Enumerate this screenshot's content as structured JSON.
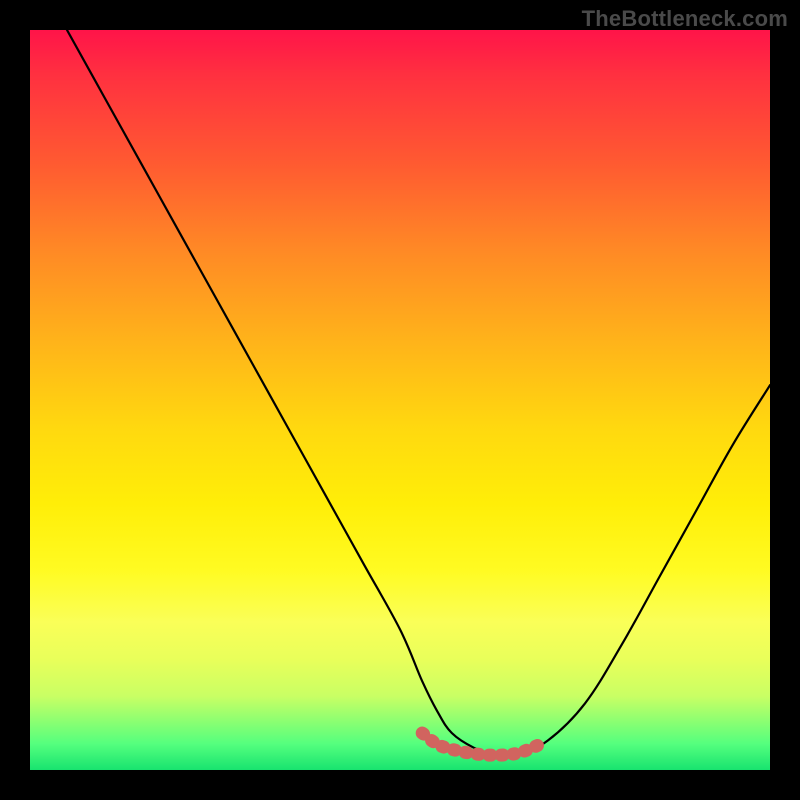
{
  "watermark": "TheBottleneck.com",
  "chart_data": {
    "type": "line",
    "title": "",
    "xlabel": "",
    "ylabel": "",
    "xlim": [
      0,
      100
    ],
    "ylim": [
      0,
      100
    ],
    "grid": false,
    "legend": false,
    "series": [
      {
        "name": "main-curve",
        "color": "#000000",
        "x": [
          5,
          10,
          15,
          20,
          25,
          30,
          35,
          40,
          45,
          50,
          53,
          55,
          57,
          60,
          63,
          66,
          70,
          75,
          80,
          85,
          90,
          95,
          100
        ],
        "y": [
          100,
          91,
          82,
          73,
          64,
          55,
          46,
          37,
          28,
          19,
          12,
          8,
          5,
          3,
          2,
          2.2,
          4,
          9,
          17,
          26,
          35,
          44,
          52
        ]
      },
      {
        "name": "bottom-highlight",
        "color": "#d1645f",
        "x": [
          53,
          55,
          57,
          60,
          63,
          66,
          69
        ],
        "y": [
          5,
          3.5,
          2.8,
          2.2,
          2.0,
          2.3,
          3.5
        ]
      }
    ],
    "gradient_stops": [
      {
        "offset": 0,
        "color": "#ff1449"
      },
      {
        "offset": 18,
        "color": "#ff5a31"
      },
      {
        "offset": 42,
        "color": "#ffb31a"
      },
      {
        "offset": 64,
        "color": "#ffee08"
      },
      {
        "offset": 85,
        "color": "#e9ff5a"
      },
      {
        "offset": 100,
        "color": "#18e36f"
      }
    ]
  }
}
